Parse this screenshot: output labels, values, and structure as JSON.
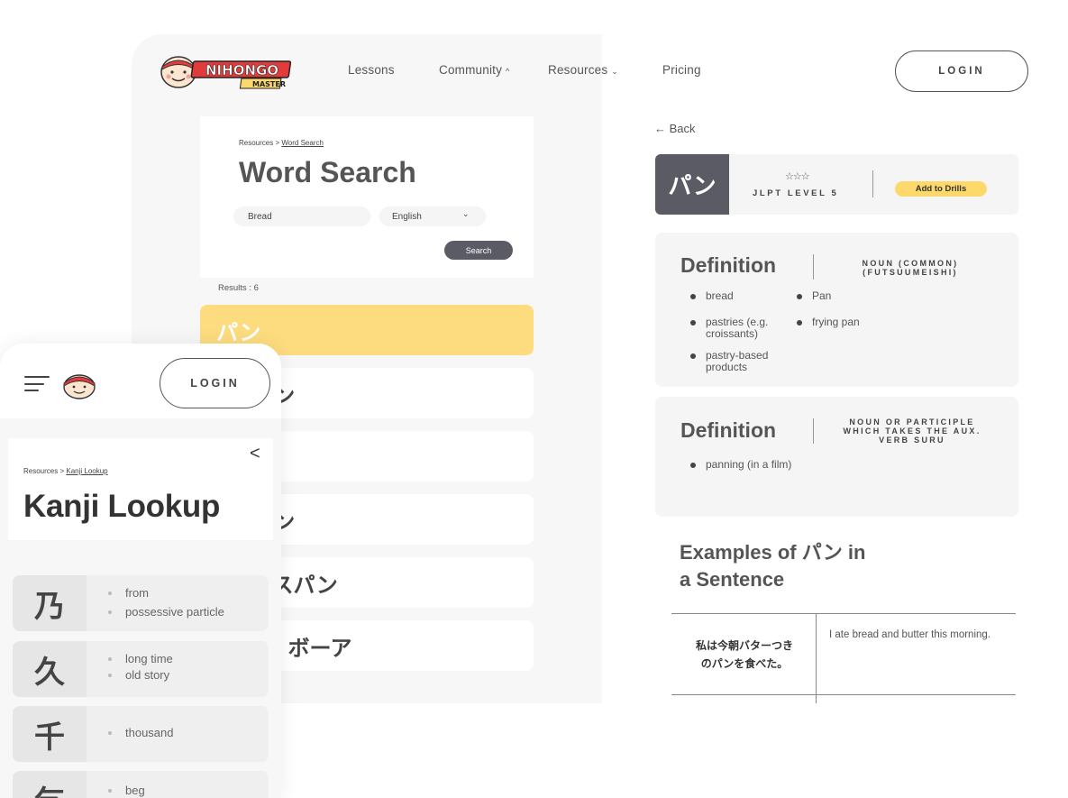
{
  "nav": {
    "lessons": "Lessons",
    "community": "Community",
    "resources": "Resources",
    "pricing": "Pricing",
    "login": "LOGIN",
    "chev_up": "^",
    "chev_down": "⌄"
  },
  "logo": {
    "text": "NIHONGO",
    "sub": "MASTER"
  },
  "word_search": {
    "crumb_root": "Resources >",
    "crumb_current": "Word Search",
    "title": "Word Search",
    "query": "Bread",
    "language": "English",
    "lang_chevron": "⌄",
    "search_label": "Search",
    "results": "Results : 6",
    "rows": [
      "パン",
      "パン",
      "",
      "パン",
      "ンスパン",
      "ル, ボーア"
    ]
  },
  "detail": {
    "back": "← Back",
    "word": "パン",
    "stars": "☆☆☆",
    "jlpt": "JLPT LEVEL 5",
    "add_drills": "Add to Drills",
    "def1": {
      "title": "Definition",
      "pos": [
        "NOUN (COMMON)",
        "(FUTSUUMEISHI)"
      ],
      "items": [
        "bread",
        "pastries (e.g. croissants)",
        "pastry-based products",
        "Pan",
        "frying pan"
      ]
    },
    "def2": {
      "title": "Definition",
      "pos": [
        "NOUN OR PARTICIPLE",
        "WHICH TAKES THE AUX.",
        "VERB SURU"
      ],
      "items": [
        "panning (in a film)"
      ]
    },
    "examples_title": [
      "Examples of パン in",
      "a Sentence"
    ],
    "example_jp": [
      "私は今朝バターつき",
      "のパンを食べた。"
    ],
    "example_en": "I ate bread and butter this morning."
  },
  "mobile": {
    "login": "LOGIN",
    "crumb_root": "Resources >",
    "crumb_current": "Kanji Lookup",
    "title": "Kanji Lookup",
    "back_chevron": "<",
    "kanji": [
      {
        "char": "乃",
        "meanings": [
          "from",
          "possessive particle"
        ]
      },
      {
        "char": "久",
        "meanings": [
          "long time",
          "old story"
        ]
      },
      {
        "char": "千",
        "meanings": [
          "thousand"
        ]
      },
      {
        "char": "乞",
        "meanings": [
          "beg"
        ]
      }
    ]
  },
  "colors": {
    "accent": "#fddc7f",
    "dark": "#5b5b66",
    "bg": "#f7f7f7"
  }
}
